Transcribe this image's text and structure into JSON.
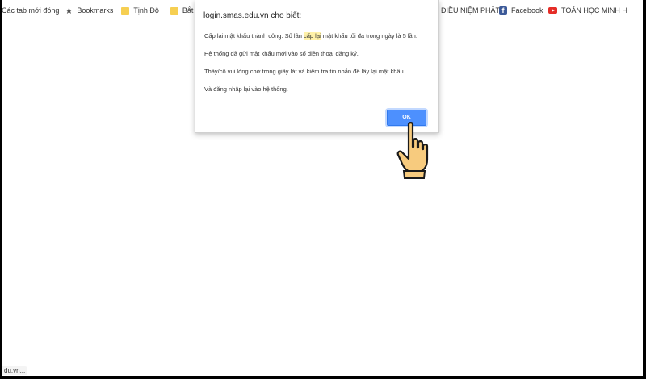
{
  "bookmarks_bar": {
    "items": [
      {
        "label": "Các tab mới đóng",
        "icon": "none"
      },
      {
        "label": "Bookmarks",
        "icon": "star-icon"
      },
      {
        "label": "Tịnh Độ",
        "icon": "folder-icon"
      },
      {
        "label": "Bắt đầu",
        "icon": "folder-icon"
      }
    ],
    "right_items": [
      {
        "label": "M ĐIỀU NIỆM PHẬT",
        "icon": "none"
      },
      {
        "label": "Facebook",
        "icon": "facebook-icon"
      },
      {
        "label": "TOÁN HỌC MINH H",
        "icon": "youtube-icon"
      }
    ]
  },
  "dialog": {
    "title": "login.smas.edu.vn cho biết:",
    "para1_before": "Cấp lại mật khẩu thành công. Số lần ",
    "para1_highlight": "cấp lại",
    "para1_after": " mật khẩu tối đa trong ngày là 5 lần.",
    "para2": "Hệ thống đã gửi mật khẩu mới vào số điện thoại đăng ký.",
    "para3": "Thầy/cô vui lòng chờ trong giây lát và kiểm tra tin nhắn để lấy lại mật khẩu.",
    "para4": "Và đăng nhập lại vào hệ thống.",
    "ok_label": "OK"
  },
  "status_bar": {
    "text": "du.vn..."
  },
  "colors": {
    "ok_button": "#4d90fe",
    "highlight": "#fff1a8",
    "hand_skin": "#f7cb7e"
  }
}
